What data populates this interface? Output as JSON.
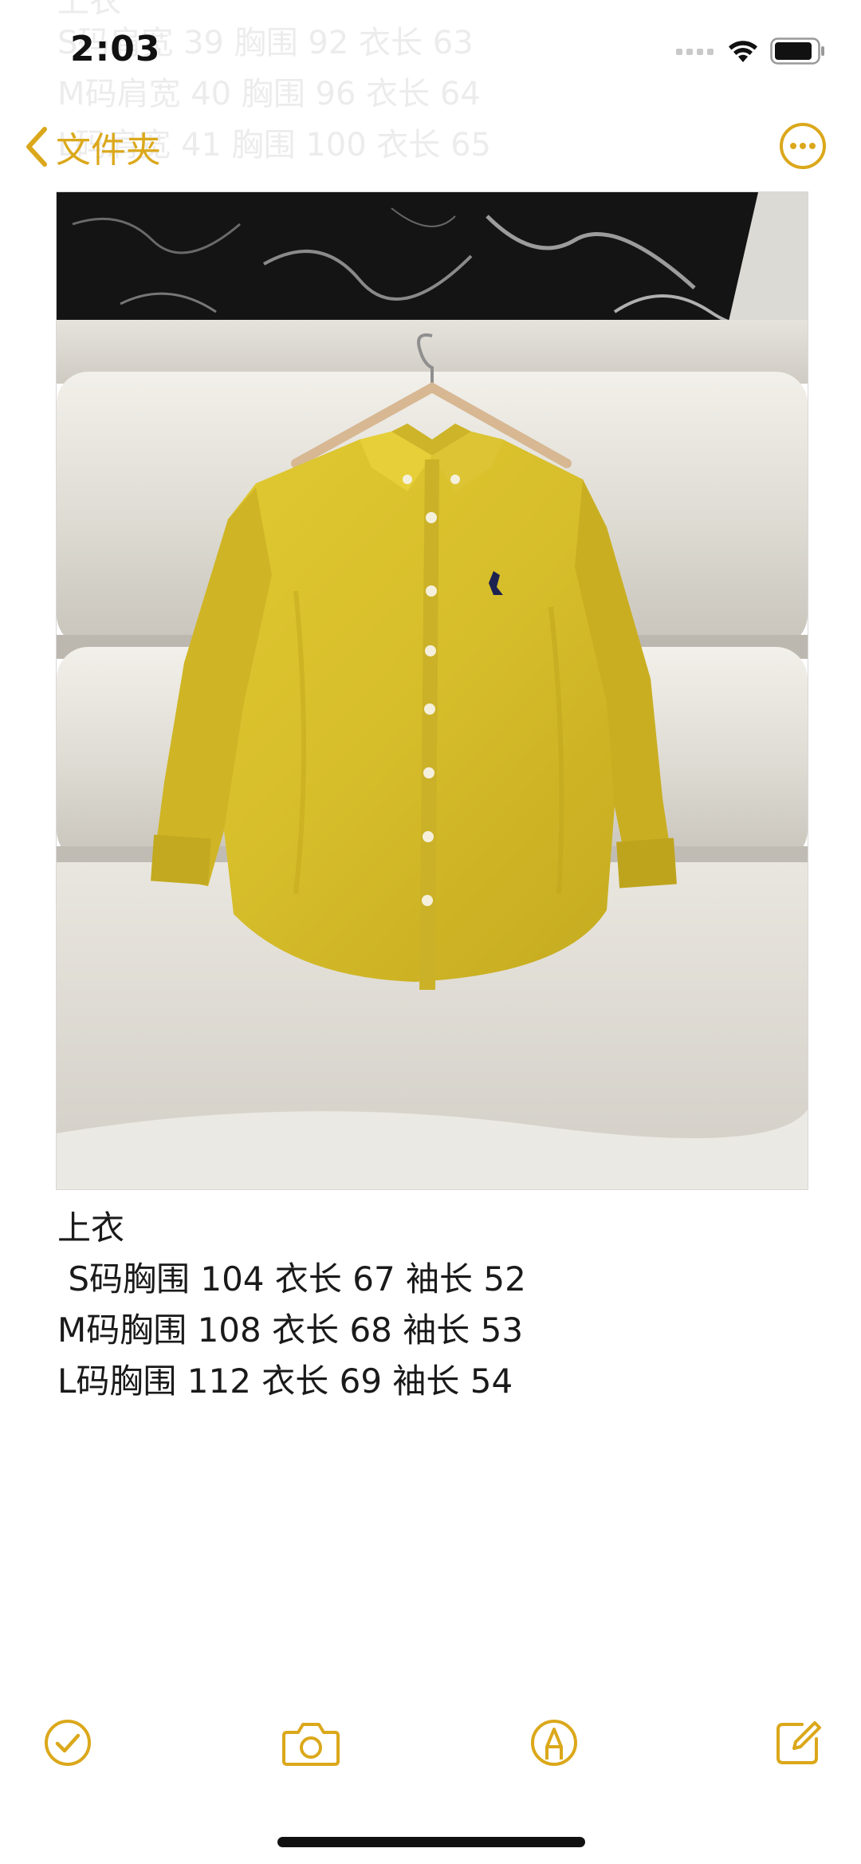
{
  "status_bar": {
    "time": "2:03"
  },
  "nav": {
    "back_label": "文件夹"
  },
  "ghost_lines": [
    "上衣",
    "S码肩宽 39 胸围 92 衣长 63",
    "M码肩宽 40 胸围 96 衣长 64",
    "L码肩宽 41 胸围 100 衣长 65"
  ],
  "note": {
    "lines": [
      "上衣",
      " S码胸围 104 衣长 67 袖长 52",
      "M码胸围 108 衣长 68 袖长 53",
      "L码胸围 112 衣长 69 袖长 54"
    ]
  },
  "toolbar": {
    "icons": [
      "checklist-icon",
      "camera-icon",
      "markup-icon",
      "compose-icon"
    ]
  },
  "colors": {
    "accent": "#dba81b",
    "shirt": "#d6bd2a",
    "text": "#1a1a1a"
  }
}
